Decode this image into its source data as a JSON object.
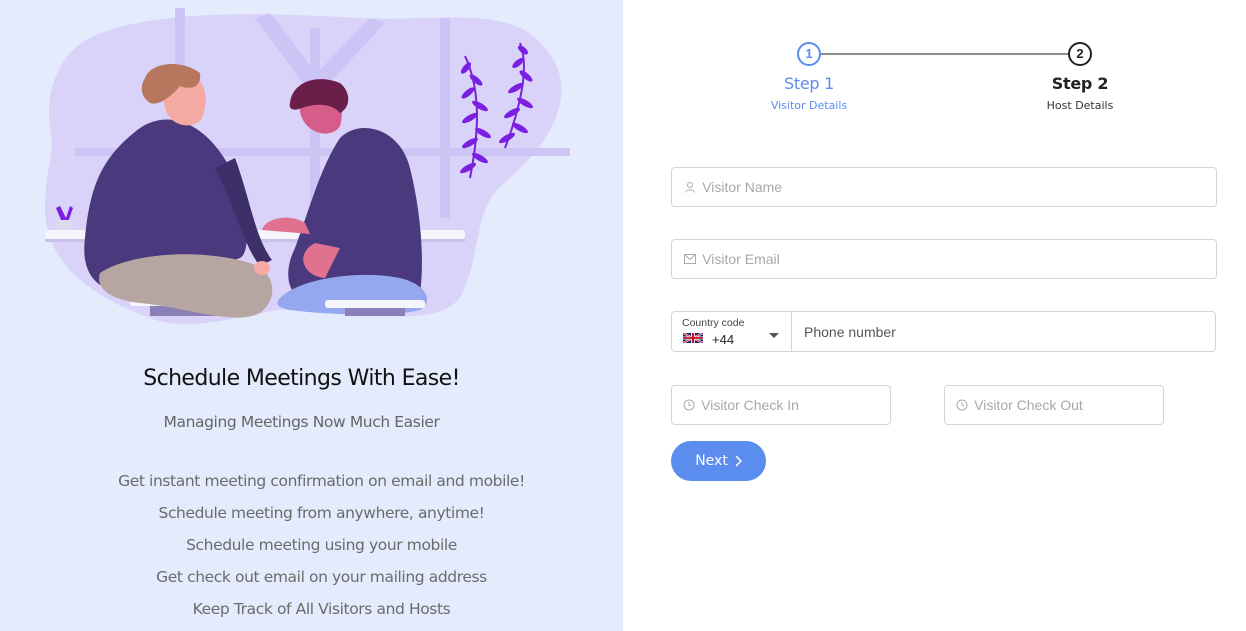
{
  "left_panel": {
    "headline": "Schedule Meetings With Ease!",
    "subheadline": "Managing Meetings Now Much Easier",
    "features": [
      "Get instant meeting confirmation on email and mobile!",
      "Schedule meeting from anywhere, anytime!",
      "Schedule meeting using your mobile",
      "Get check out email on your mailing address",
      "Keep Track of All Visitors and Hosts"
    ]
  },
  "stepper": {
    "steps": [
      {
        "number": "1",
        "title": "Step 1",
        "subtitle": "Visitor Details",
        "state": "active"
      },
      {
        "number": "2",
        "title": "Step 2",
        "subtitle": "Host Details",
        "state": "pending"
      }
    ]
  },
  "form": {
    "visitor_name_placeholder": "Visitor Name",
    "visitor_email_placeholder": "Visitor Email",
    "country_code_label": "Country code",
    "country_code_value": "+44",
    "country_flag": "uk-flag-icon",
    "phone_placeholder": "Phone number",
    "check_in_placeholder": "Visitor Check In",
    "check_out_placeholder": "Visitor Check Out",
    "next_label": "Next"
  },
  "colors": {
    "accent": "#5b8def",
    "left_bg": "#e3ebfd",
    "illustration_purple": "#4a3a7d",
    "plant_purple": "#7b1fe0"
  }
}
